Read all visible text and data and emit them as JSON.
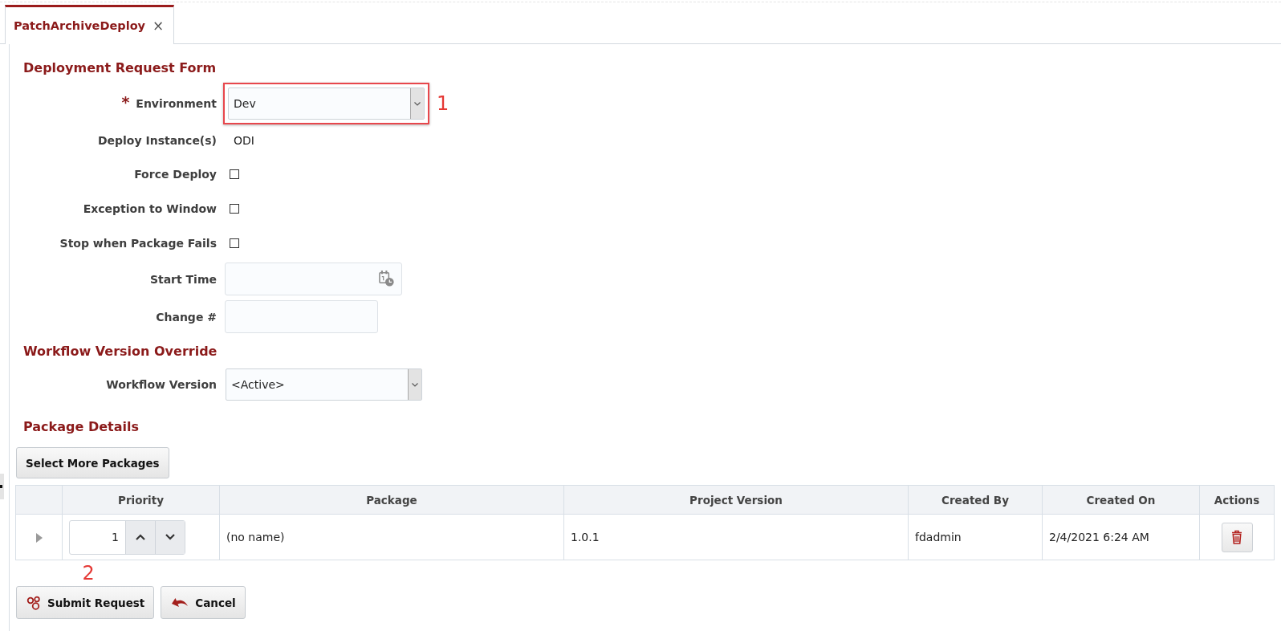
{
  "tabs": [
    {
      "label": "PatchArchiveDeploy",
      "close": "×",
      "selected": true
    }
  ],
  "form": {
    "title": "Deployment Request Form",
    "required_mark": "*",
    "fields": [
      {
        "kind": "select",
        "label": "Environment",
        "required": true,
        "value": "Dev",
        "highlighted": true,
        "callout": "1"
      },
      {
        "kind": "text",
        "label": "Deploy Instance(s)",
        "required": false,
        "value": "ODI"
      },
      {
        "kind": "checkbox",
        "label": "Force Deploy",
        "required": false,
        "checked": false
      },
      {
        "kind": "checkbox",
        "label": "Exception to Window",
        "required": false,
        "checked": false
      },
      {
        "kind": "checkbox",
        "label": "Stop when Package Fails",
        "required": false,
        "checked": false
      },
      {
        "kind": "datetime",
        "label": "Start Time",
        "required": false
      },
      {
        "kind": "input",
        "label": "Change #",
        "required": false
      }
    ]
  },
  "workflow": {
    "title": "Workflow Version Override",
    "fields": [
      {
        "kind": "select",
        "label": "Workflow Version",
        "required": false,
        "value": "<Active>",
        "highlighted": false
      }
    ]
  },
  "packages": {
    "title": "Package Details",
    "add_button": "Select More Packages",
    "table": {
      "columns": [
        "Priority",
        "Package",
        "Project Version",
        "Created By",
        "Created On",
        "Actions"
      ],
      "rows": [
        {
          "expanded": false,
          "priority": "1",
          "package": "(no name)",
          "project_version": "1.0.1",
          "created_by": "fdadmin",
          "created_on": "2/4/2021 6:24 AM"
        }
      ]
    }
  },
  "buttons": [
    {
      "kind": "submit",
      "label": "Submit Request",
      "callout": "2"
    },
    {
      "kind": "cancel",
      "label": "Cancel"
    }
  ]
}
